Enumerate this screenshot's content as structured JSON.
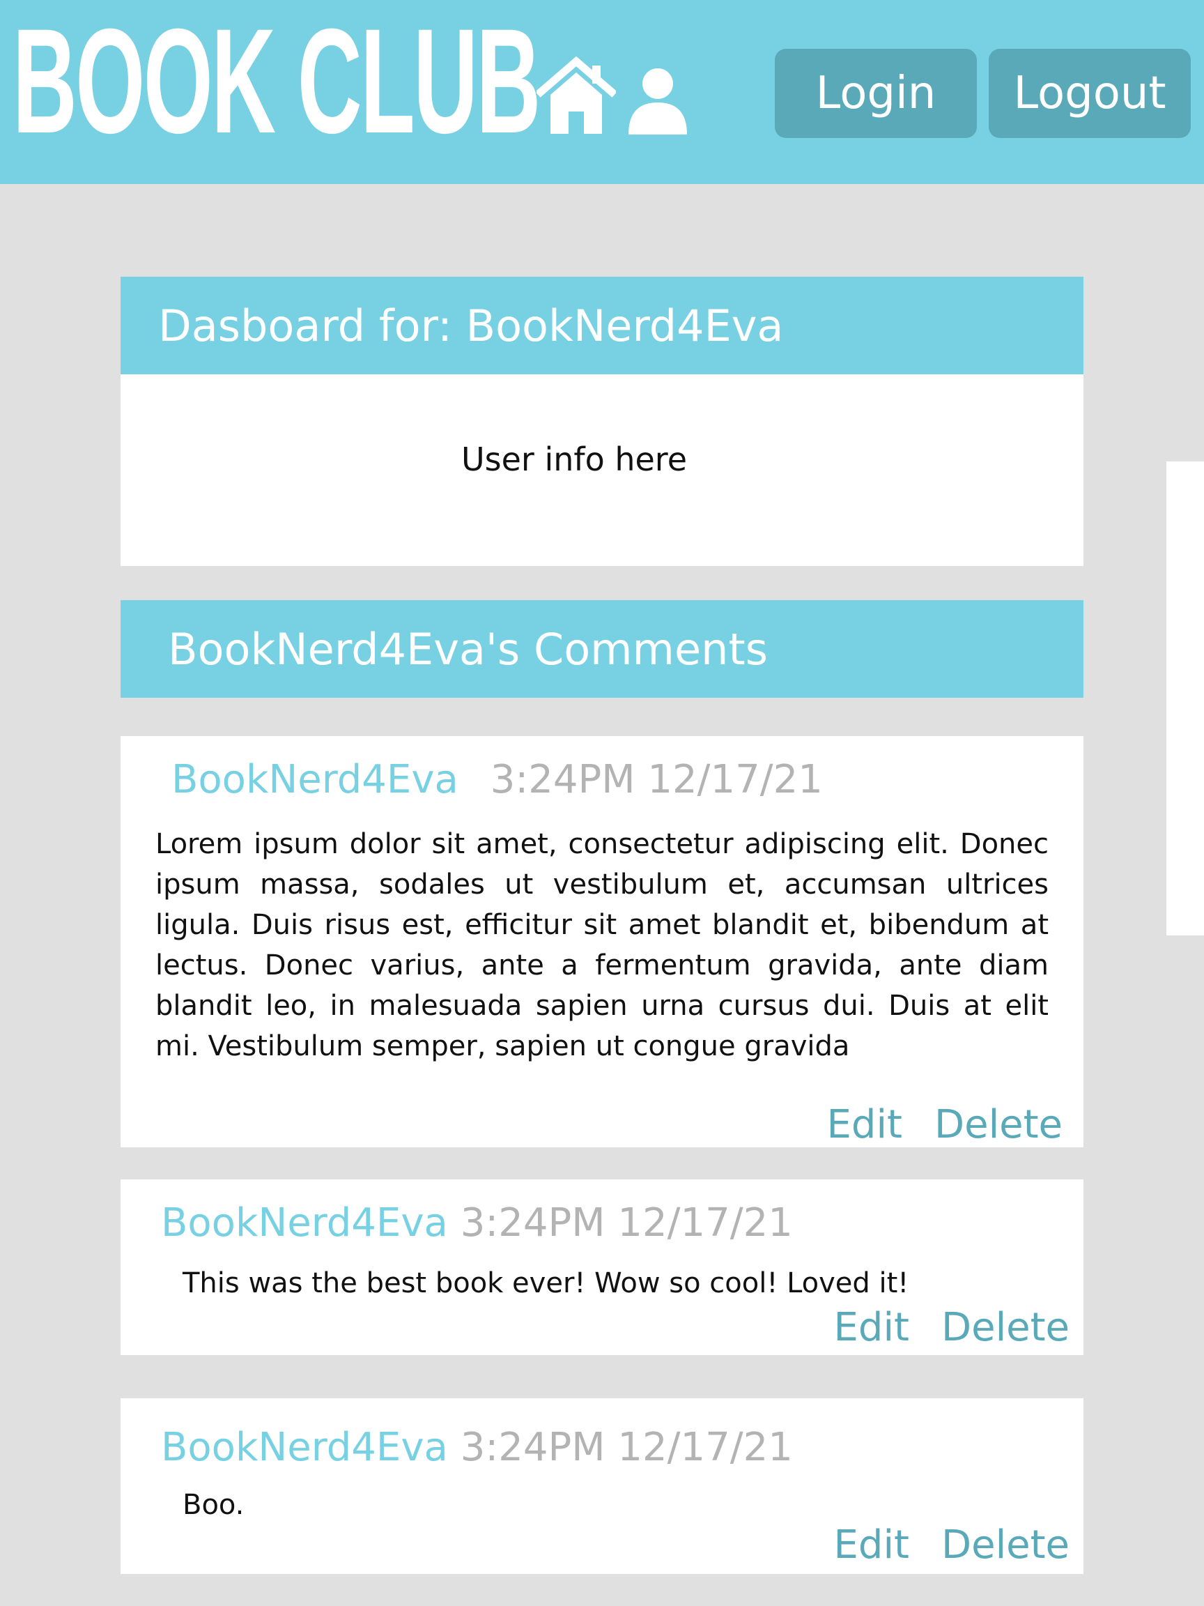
{
  "header": {
    "logo_text": "BOOK CLUB",
    "login_label": "Login",
    "logout_label": "Logout",
    "icons": [
      "home-icon",
      "user-icon"
    ]
  },
  "dashboard": {
    "title": "Dasboard for:  BookNerd4Eva",
    "user_info": "User info here"
  },
  "comments_section": {
    "title": "BookNerd4Eva's Comments",
    "comments": [
      {
        "author": "BookNerd4Eva",
        "time": "3:24PM 12/17/21",
        "text": "Lorem ipsum dolor sit amet, consectetur adipiscing elit. Donec ipsum massa, sodales ut vestibulum et, accumsan ultrices ligula. Duis risus est, efficitur sit amet blandit et, bibendum at lectus. Donec varius, ante a fermentum gravida, ante diam blandit leo, in malesuada sapien urna cursus dui. Duis at elit mi. Vestibulum semper, sapien ut congue gravida",
        "edit_label": "Edit",
        "delete_label": "Delete"
      },
      {
        "author": "BookNerd4Eva",
        "time": "3:24PM 12/17/21",
        "text": "This was the best book ever! Wow so cool! Loved it!",
        "edit_label": "Edit",
        "delete_label": "Delete"
      },
      {
        "author": "BookNerd4Eva",
        "time": "3:24PM 12/17/21",
        "text": "Boo.",
        "edit_label": "Edit",
        "delete_label": "Delete"
      }
    ]
  },
  "colors": {
    "accent": "#77d1e2",
    "button": "#5aa9b9",
    "background": "#e0e0e0",
    "timestamp": "#b3b3b3"
  }
}
